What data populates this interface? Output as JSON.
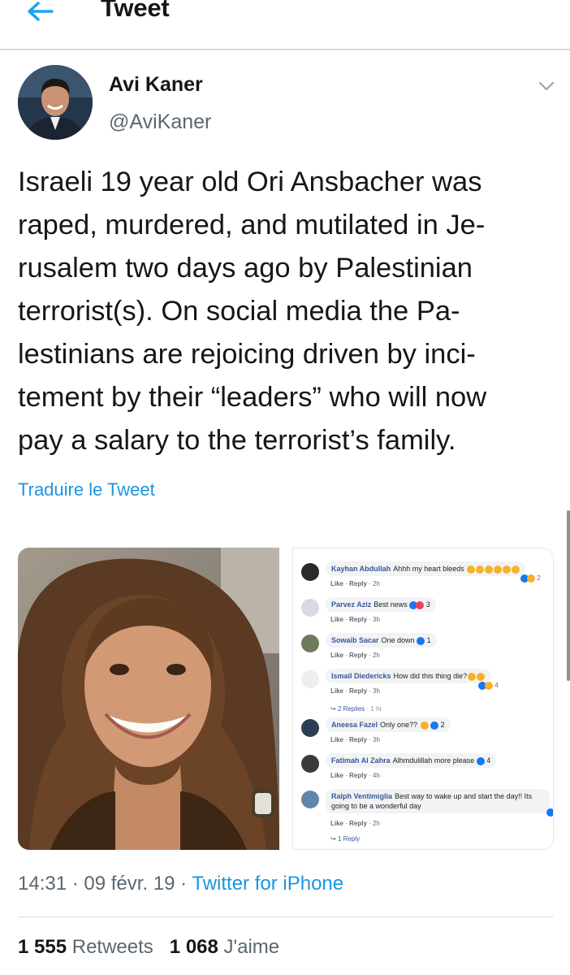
{
  "header": {
    "title": "Tweet",
    "back_icon": "arrow-left-icon"
  },
  "author": {
    "name": "Avi Kaner",
    "handle": "@AviKaner",
    "menu_icon": "chevron-down-icon"
  },
  "tweet": {
    "lines": [
      "Israeli 19 year old Ori Ansbacher was",
      "raped, murdered, and mutilated in Je-",
      "rusalem two days ago by Palestinian",
      "terrorist(s). On social media the Pa-",
      "lestinians are rejoicing driven by inci-",
      "tement by their “leaders” who will now",
      "pay a salary to the terrorist’s family."
    ],
    "translate": "Traduire le Tweet"
  },
  "screenshot_comments": [
    {
      "name": "Kayhan Abdullah",
      "text": "Ahhh my heart bleeds",
      "meta_like": "Like",
      "meta_reply": "Reply",
      "time": "2h",
      "reactions": "2"
    },
    {
      "name": "Parvez Aziz",
      "text": "Best news",
      "meta_like": "Like",
      "meta_reply": "Reply",
      "time": "3h",
      "reactions": "3"
    },
    {
      "name": "Sowaib Sacar",
      "text": "One down",
      "meta_like": "Like",
      "meta_reply": "Reply",
      "time": "2h",
      "reactions": "1"
    },
    {
      "name": "Ismail Diedericks",
      "text": "How did this thing die?",
      "meta_like": "Like",
      "meta_reply": "Reply",
      "time": "3h",
      "reactions": "4"
    },
    {
      "name": "Aneesa Fazel",
      "text": "Only one??",
      "meta_like": "Like",
      "meta_reply": "Reply",
      "time": "3h",
      "reactions": "2"
    },
    {
      "name": "Fatimah Al Zahra",
      "text": "Alhmdulillah more please",
      "meta_like": "Like",
      "meta_reply": "Reply",
      "time": "4h",
      "reactions": "4"
    },
    {
      "name": "Ralph Ventimiglia",
      "text": "Best way to wake up and start the day!! Its",
      "text2": "going to be a wonderful day",
      "meta_like": "Like",
      "meta_reply": "Reply",
      "time": "2h"
    }
  ],
  "screenshot_subreplies": {
    "replies_a": "2 Replies",
    "replies_a_time": "1 hr",
    "replies_b": "1 Reply"
  },
  "footer": {
    "time": "14:31",
    "date": "09 févr. 19",
    "client": "Twitter for iPhone",
    "retweets_count": "1 555",
    "retweets_label": "Retweets",
    "likes_count": "1 068",
    "likes_label": "J'aime"
  },
  "colors": {
    "link": "#1b95e0",
    "muted": "#5b6770",
    "text": "#14171a"
  }
}
